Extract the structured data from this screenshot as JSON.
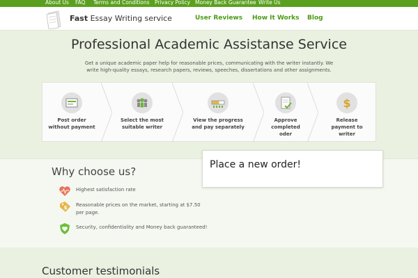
{
  "topbar": {
    "links": [
      "About Us",
      "FAQ",
      "Terms and Conditions",
      "Privacy Policy",
      "Money Back Guarantee",
      "Write Us"
    ]
  },
  "logo": {
    "bold": "Fast",
    "rest": "Essay Writing service"
  },
  "nav": [
    "User Reviews",
    "How It Works",
    "Blog"
  ],
  "hero": {
    "title": "Professional Academic Assistanse Service",
    "description": "Get a unique academic paper help for reasonable prices, communicating with the writer instantly. We write high-quality essays, research papers, reviews, speeches, dissertations and other assignments."
  },
  "steps": [
    {
      "label": "Post order without payment",
      "icon": "order-form-icon"
    },
    {
      "label": "Select the most suitable writer",
      "icon": "writers-icon"
    },
    {
      "label": "View the progress and pay separately",
      "icon": "progress-icon"
    },
    {
      "label": "Approve completed oder",
      "icon": "approve-document-icon"
    },
    {
      "label": "Release payment to writer",
      "icon": "dollar-icon"
    }
  ],
  "why": {
    "title": "Why choose us?",
    "items": [
      {
        "text": "Highest satisfaction rate",
        "icon": "heart-icon",
        "color": "#e8735a"
      },
      {
        "text": "Reasonable prices on the market, starting at $7.50 per page.",
        "icon": "price-tag-icon",
        "color": "#e6b54a"
      },
      {
        "text": "Security, confidentiality and Money back guaranteed!",
        "icon": "shield-heart-icon",
        "color": "#6cbf3a"
      }
    ]
  },
  "order": {
    "title": "Place a new order!"
  },
  "testimonials": {
    "title": "Customer testimonials"
  },
  "colors": {
    "brand": "#5aa01e",
    "nav": "#4d9a14",
    "background": "#eaf1e0"
  }
}
